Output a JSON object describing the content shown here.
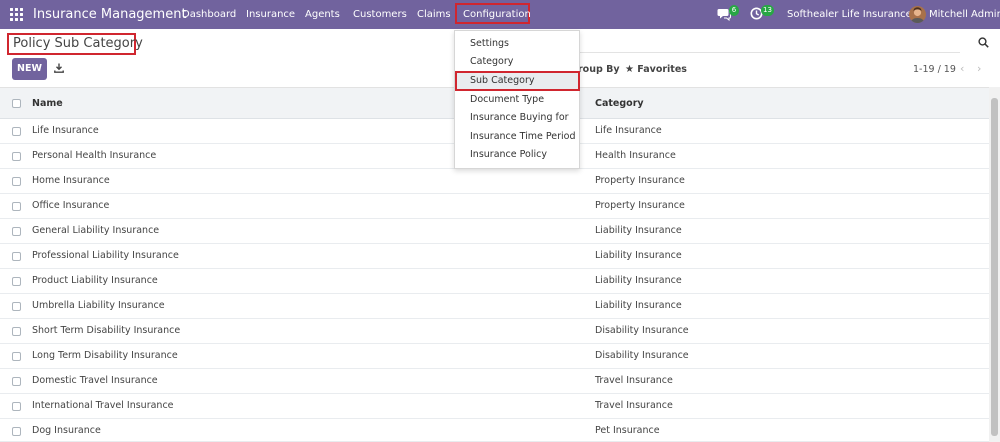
{
  "navbar": {
    "brand": "Insurance Management",
    "menu": [
      "Dashboard",
      "Insurance",
      "Agents",
      "Customers",
      "Claims",
      "Configuration"
    ],
    "messages_count": "6",
    "activities_count": "13",
    "company": "Softhealer Life Insurance",
    "user": "Mitchell Admin"
  },
  "control": {
    "title": "Policy Sub Category",
    "new_label": "NEW",
    "group_by": "roup By",
    "favorites": "Favorites",
    "pager": "1-19 / 19"
  },
  "dropdown": {
    "items": [
      "Settings",
      "Category",
      "Sub Category",
      "Document Type",
      "Insurance Buying for",
      "Insurance Time Period",
      "Insurance Policy"
    ]
  },
  "table": {
    "columns": [
      "Name",
      "Category"
    ],
    "rows": [
      [
        "Life Insurance",
        "Life Insurance"
      ],
      [
        "Personal Health Insurance",
        "Health Insurance"
      ],
      [
        "Home Insurance",
        "Property Insurance"
      ],
      [
        "Office Insurance",
        "Property Insurance"
      ],
      [
        "General Liability Insurance",
        "Liability Insurance"
      ],
      [
        "Professional Liability Insurance",
        "Liability Insurance"
      ],
      [
        "Product Liability Insurance",
        "Liability Insurance"
      ],
      [
        "Umbrella Liability Insurance",
        "Liability Insurance"
      ],
      [
        "Short Term Disability Insurance",
        "Disability Insurance"
      ],
      [
        "Long Term Disability Insurance",
        "Disability Insurance"
      ],
      [
        "Domestic Travel Insurance",
        "Travel Insurance"
      ],
      [
        "International Travel Insurance",
        "Travel Insurance"
      ],
      [
        "Dog Insurance",
        "Pet Insurance"
      ]
    ]
  },
  "colors": {
    "brand": "#71639e",
    "highlight_border": "#d0262f",
    "badge": "#28a745"
  },
  "icons": [
    "apps-grid-icon",
    "chat-icon",
    "clock-icon",
    "search-icon",
    "download-icon",
    "star-icon",
    "chevron-left-icon",
    "chevron-right-icon"
  ]
}
